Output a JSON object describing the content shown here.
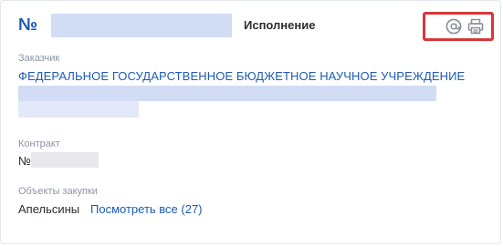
{
  "header": {
    "number_prefix": "№",
    "status": "Исполнение",
    "email_icon": "at-sign-icon",
    "print_icon": "printer-icon"
  },
  "customer": {
    "label": "Заказчик",
    "name": "ФЕДЕРАЛЬНОЕ ГОСУДАРСТВЕННОЕ БЮДЖЕТНОЕ НАУЧНОЕ УЧРЕЖДЕНИЕ"
  },
  "contract": {
    "label": "Контракт",
    "number_prefix": "№"
  },
  "purchase_objects": {
    "label": "Объекты закупки",
    "item": "Апельсины",
    "see_all_link": "Посмотреть все (27)"
  },
  "colors": {
    "accent": "#1e5bb5",
    "highlight_border": "#d7363a",
    "icon_gray": "#8a8f99"
  }
}
